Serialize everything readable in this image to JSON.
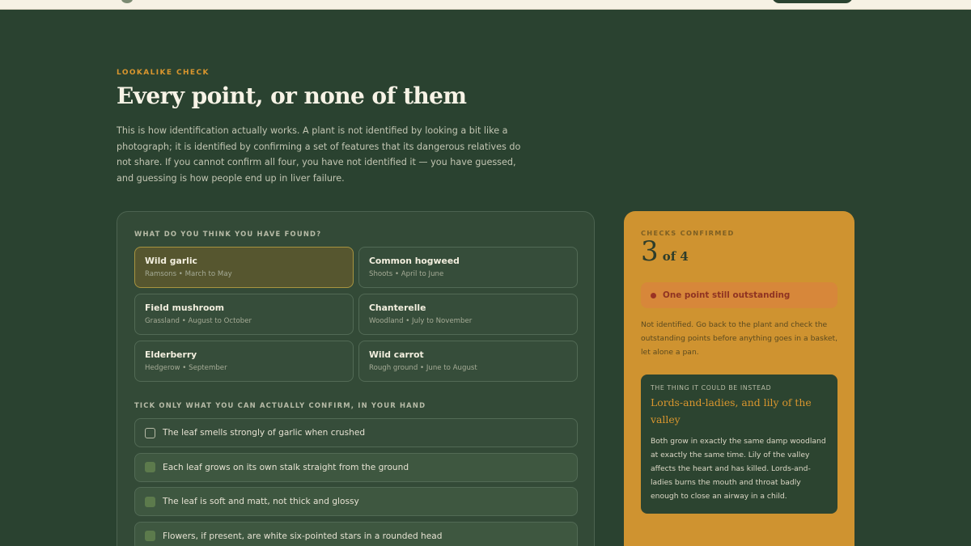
{
  "header": {
    "eyebrow": "LOOKALIKE CHECK",
    "title": "Every point, or none of them",
    "intro": "This is how identification actually works. A plant is not identified by looking a bit like a photograph; it is identified by confirming a set of features that its dangerous relatives do not share. If you cannot confirm all four, you have not identified it — you have guessed, and guessing is how people end up in liver failure."
  },
  "found": {
    "label": "WHAT DO YOU THINK YOU HAVE FOUND?",
    "selected": "Wild garlic",
    "options": [
      {
        "name": "Wild garlic",
        "sub": "Ramsons • March to May"
      },
      {
        "name": "Common hogweed",
        "sub": "Shoots • April to June"
      },
      {
        "name": "Field mushroom",
        "sub": "Grassland • August to October"
      },
      {
        "name": "Chanterelle",
        "sub": "Woodland • July to November"
      },
      {
        "name": "Elderberry",
        "sub": "Hedgerow • September"
      },
      {
        "name": "Wild carrot",
        "sub": "Rough ground • June to August"
      }
    ]
  },
  "checks": {
    "label": "TICK ONLY WHAT YOU CAN ACTUALLY CONFIRM, IN YOUR HAND",
    "items": [
      {
        "text": "The leaf smells strongly of garlic when crushed",
        "checked": false
      },
      {
        "text": "Each leaf grows on its own stalk straight from the ground",
        "checked": true
      },
      {
        "text": "The leaf is soft and matt, not thick and glossy",
        "checked": true
      },
      {
        "text": "Flowers, if present, are white six-pointed stars in a rounded head",
        "checked": true
      }
    ]
  },
  "summary": {
    "eyebrow": "CHECKS CONFIRMED",
    "confirmed": "3",
    "total_text": "of 4",
    "status": "One point still outstanding",
    "note": "Not identified. Go back to the plant and check the outstanding points before anything goes in a basket, let alone a pan.",
    "danger": {
      "eyebrow": "THE THING IT COULD BE INSTEAD",
      "title": "Lords-and-ladies, and lily of the valley",
      "body": "Both grow in exactly the same damp woodland at exactly the same time. Lily of the valley affects the heart and has killed. Lords-and-ladies burns the mouth and throat badly enough to close an airway in a child."
    }
  },
  "colors": {
    "background": "#2a4230",
    "accent": "#d9962e",
    "summary_panel": "#cf9330",
    "alert": "#9a3324"
  }
}
